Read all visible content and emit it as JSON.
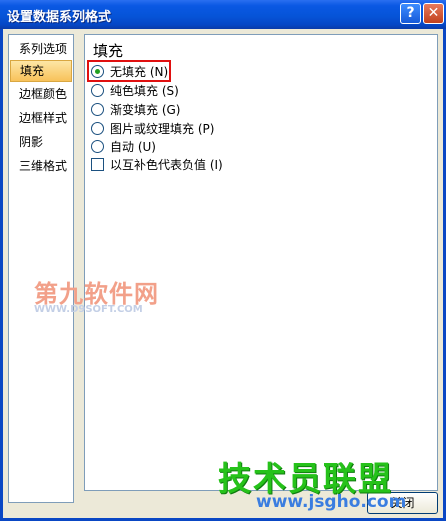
{
  "window": {
    "title": "设置数据系列格式",
    "help_glyph": "?",
    "close_glyph": "✕"
  },
  "sidebar": {
    "items": [
      {
        "label": "系列选项"
      },
      {
        "label": "填充"
      },
      {
        "label": "边框颜色"
      },
      {
        "label": "边框样式"
      },
      {
        "label": "阴影"
      },
      {
        "label": "三维格式"
      }
    ],
    "selected": "填充"
  },
  "panel": {
    "section_title": "填充",
    "options": [
      {
        "label": "无填充 (N)",
        "type": "radio",
        "checked": true
      },
      {
        "label": "纯色填充 (S)",
        "type": "radio",
        "checked": false
      },
      {
        "label": "渐变填充 (G)",
        "type": "radio",
        "checked": false
      },
      {
        "label": "图片或纹理填充 (P)",
        "type": "radio",
        "checked": false
      },
      {
        "label": "自动 (U)",
        "type": "radio",
        "checked": false
      },
      {
        "label": "以互补色代表负值 (I)",
        "type": "checkbox",
        "checked": false
      }
    ]
  },
  "footer": {
    "close_label": "关闭"
  },
  "watermarks": {
    "top_text": "第九软件网",
    "top_sub": "WWW.D9SOFT.COM",
    "bottom_text": "技术员联盟",
    "bottom_sub": "www.jsgho.com"
  },
  "colors": {
    "titlebar": "#0654d8",
    "highlight_border": "#e01010",
    "radio_dot": "#21a121"
  }
}
